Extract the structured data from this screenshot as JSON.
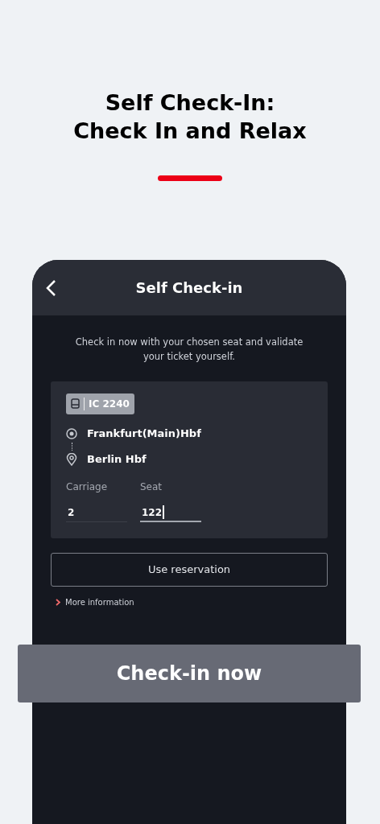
{
  "headline": [
    "Self Check-In:",
    "Check In and Relax"
  ],
  "screen": {
    "title": "Self Check-in",
    "intro": "Check in now with your chosen seat and validate your ticket yourself.",
    "train": "IC 2240",
    "stops": [
      {
        "kind": "origin",
        "name": "Frankfurt(Main)Hbf"
      },
      {
        "kind": "destination",
        "name": "Berlin Hbf"
      }
    ],
    "fields": [
      {
        "label": "Carriage",
        "value": "2",
        "focused": false
      },
      {
        "label": "Seat",
        "value": "122",
        "focused": true
      }
    ],
    "secondary_button": "Use reservation",
    "link": "More information"
  },
  "primary_button": "Check-in now"
}
